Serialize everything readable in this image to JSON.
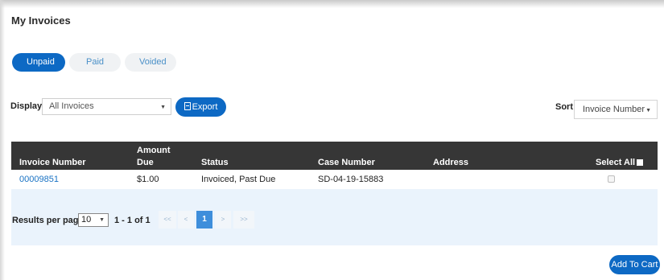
{
  "page": {
    "title": "My Invoices"
  },
  "tabs": [
    {
      "label": "Unpaid",
      "active": true
    },
    {
      "label": "Paid",
      "active": false
    },
    {
      "label": "Voided",
      "active": false
    }
  ],
  "filters": {
    "display_label": "Display",
    "display_value": "All Invoices",
    "export_label": "Export",
    "sort_label": "Sort",
    "sort_value": "Invoice Number"
  },
  "table": {
    "columns": [
      "Invoice Number",
      "Amount Due",
      "Status",
      "Case Number",
      "Address",
      "Select All"
    ],
    "amount_due_header": {
      "line1": "Amount",
      "line2": "Due"
    },
    "rows": [
      {
        "invoice_number": "00009851",
        "amount_due": "$1.00",
        "status": "Invoiced, Past Due",
        "case_number": "SD-04-19-15883",
        "address": "",
        "selected": false
      }
    ]
  },
  "pagination": {
    "results_per_page_label": "Results per page",
    "results_per_page_value": "10",
    "range_text": "1 - 1 of 1",
    "first": "<<",
    "prev": "<",
    "current_page": "1",
    "next": ">",
    "last": ">>"
  },
  "actions": {
    "add_to_cart_label": "Add To Cart"
  },
  "colors": {
    "primary": "#0d69c4",
    "header_bg": "#363636",
    "link": "#1a73c4",
    "pager_bg": "#eaf3fc"
  }
}
